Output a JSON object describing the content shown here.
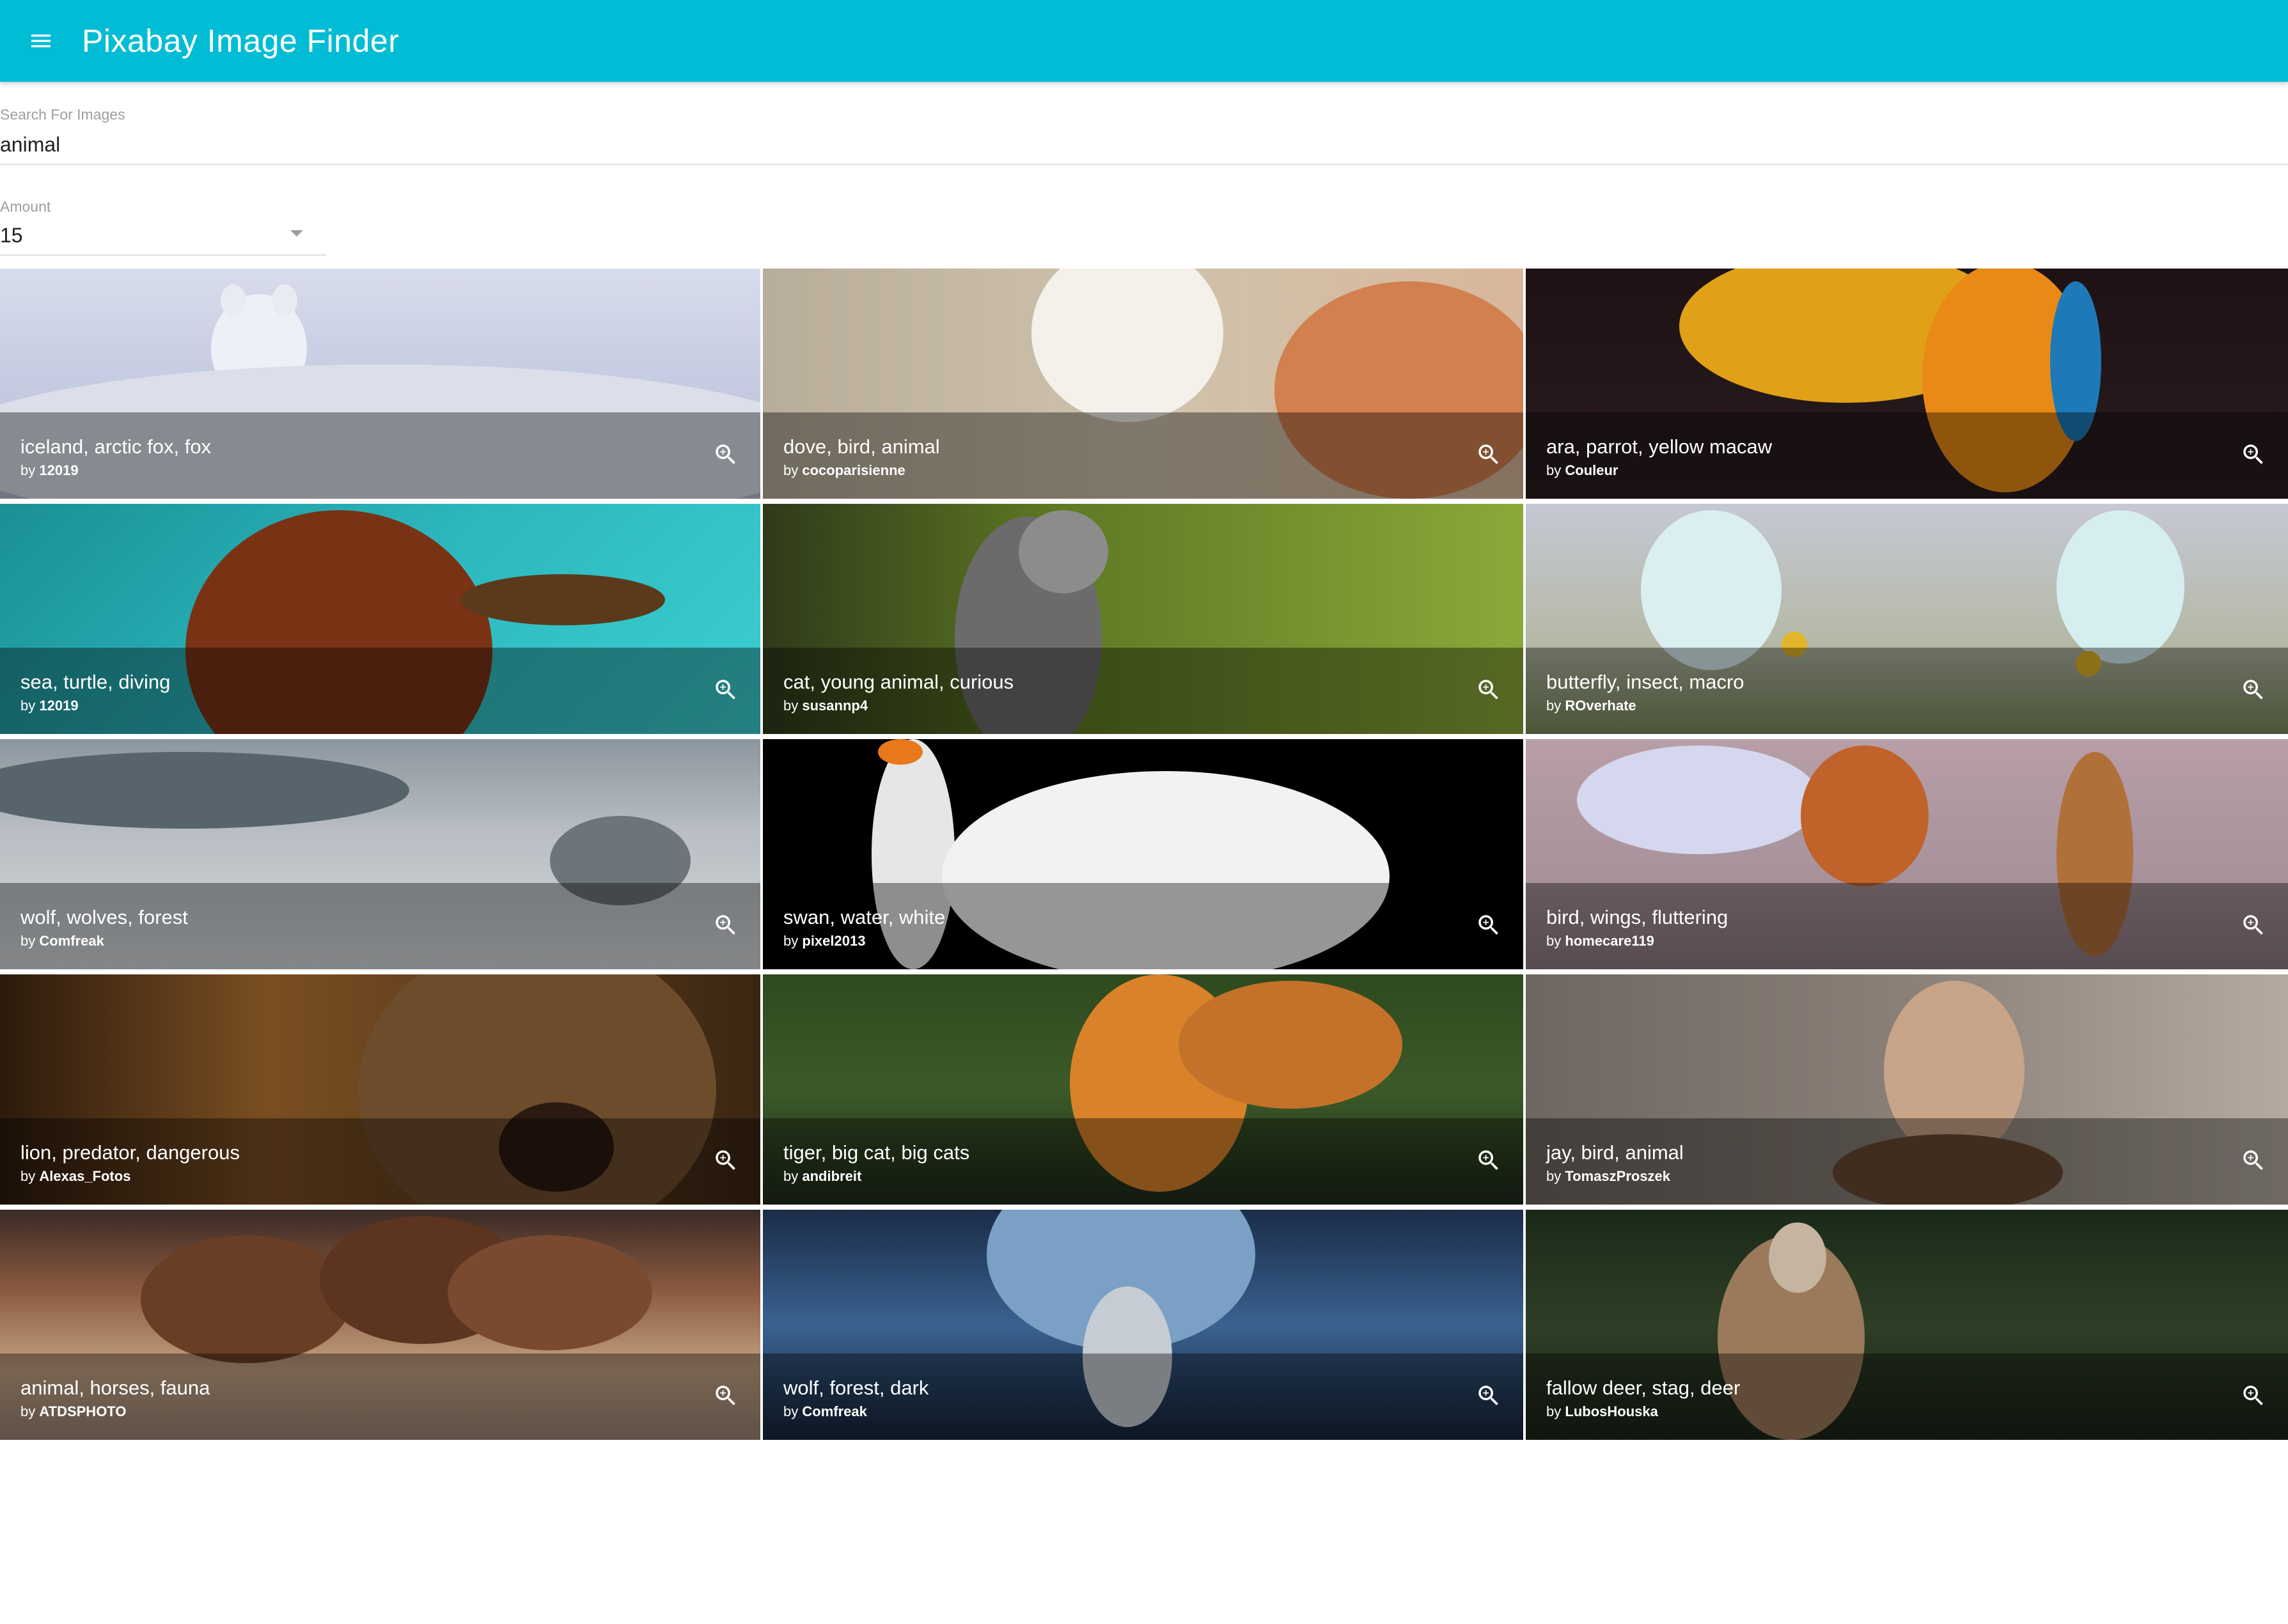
{
  "appbar": {
    "title": "Pixabay Image Finder",
    "menu_icon": "menu-icon",
    "color": "#00bcd4"
  },
  "search": {
    "label": "Search For Images",
    "value": "animal"
  },
  "amount": {
    "label": "Amount",
    "value": "15"
  },
  "tiles": [
    {
      "title": "iceland, arctic fox, fox",
      "by": "by",
      "user": "12019"
    },
    {
      "title": "dove, bird, animal",
      "by": "by",
      "user": "cocoparisienne"
    },
    {
      "title": "ara, parrot, yellow macaw",
      "by": "by",
      "user": "Couleur"
    },
    {
      "title": "sea, turtle, diving",
      "by": "by",
      "user": "12019"
    },
    {
      "title": "cat, young animal, curious",
      "by": "by",
      "user": "susannp4"
    },
    {
      "title": "butterfly, insect, macro",
      "by": "by",
      "user": "ROverhate"
    },
    {
      "title": "wolf, wolves, forest",
      "by": "by",
      "user": "Comfreak"
    },
    {
      "title": "swan, water, white",
      "by": "by",
      "user": "pixel2013"
    },
    {
      "title": "bird, wings, fluttering",
      "by": "by",
      "user": "homecare119"
    },
    {
      "title": "lion, predator, dangerous",
      "by": "by",
      "user": "Alexas_Fotos"
    },
    {
      "title": "tiger, big cat, big cats",
      "by": "by",
      "user": "andibreit"
    },
    {
      "title": "jay, bird, animal",
      "by": "by",
      "user": "TomaszProszek"
    },
    {
      "title": "animal, horses, fauna",
      "by": "by",
      "user": "ATDSPHOTO"
    },
    {
      "title": "wolf, forest, dark",
      "by": "by",
      "user": "Comfreak"
    },
    {
      "title": "fallow deer, stag, deer",
      "by": "by",
      "user": "LubosHouska"
    }
  ]
}
